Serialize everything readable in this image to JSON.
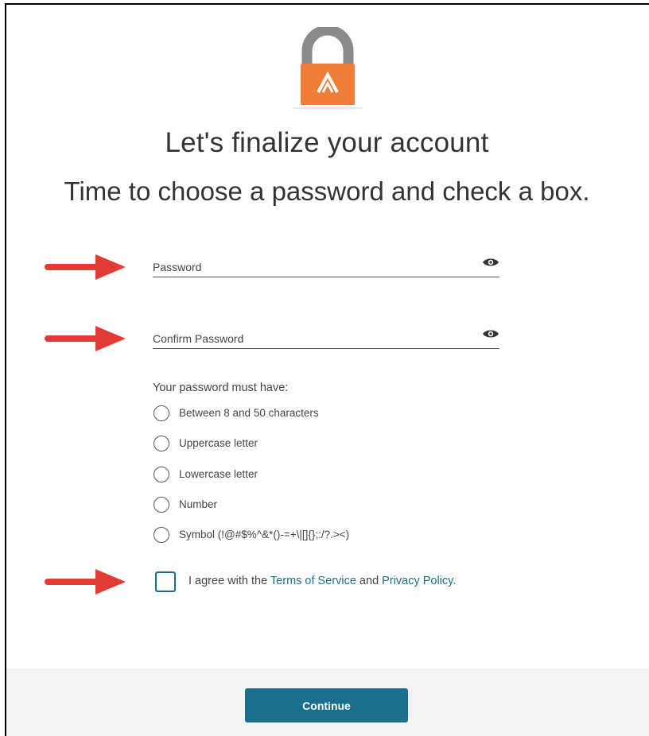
{
  "page": {
    "title": "Let's finalize your account",
    "subtitle": "Time to choose a password and check a box."
  },
  "form": {
    "password_label": "Password",
    "confirm_label": "Confirm Password",
    "requirements_title": "Your password must have:",
    "requirements": [
      "Between 8 and 50 characters",
      "Uppercase letter",
      "Lowercase letter",
      "Number",
      "Symbol (!@#$%^&*()-=+\\|[]{};:/?.><)"
    ]
  },
  "agreement": {
    "prefix": "I agree with the ",
    "terms_link": "Terms of Service",
    "middle": " and ",
    "privacy_link": "Privacy Policy",
    "suffix": "."
  },
  "actions": {
    "continue_label": "Continue"
  },
  "colors": {
    "accent": "#1b6e8c",
    "lock_orange": "#f07c3a",
    "arrow_red": "#e23b36"
  },
  "icons": {
    "logo": "padlock-logo-icon",
    "eye": "eye-icon",
    "arrow": "red-arrow-annotation"
  }
}
